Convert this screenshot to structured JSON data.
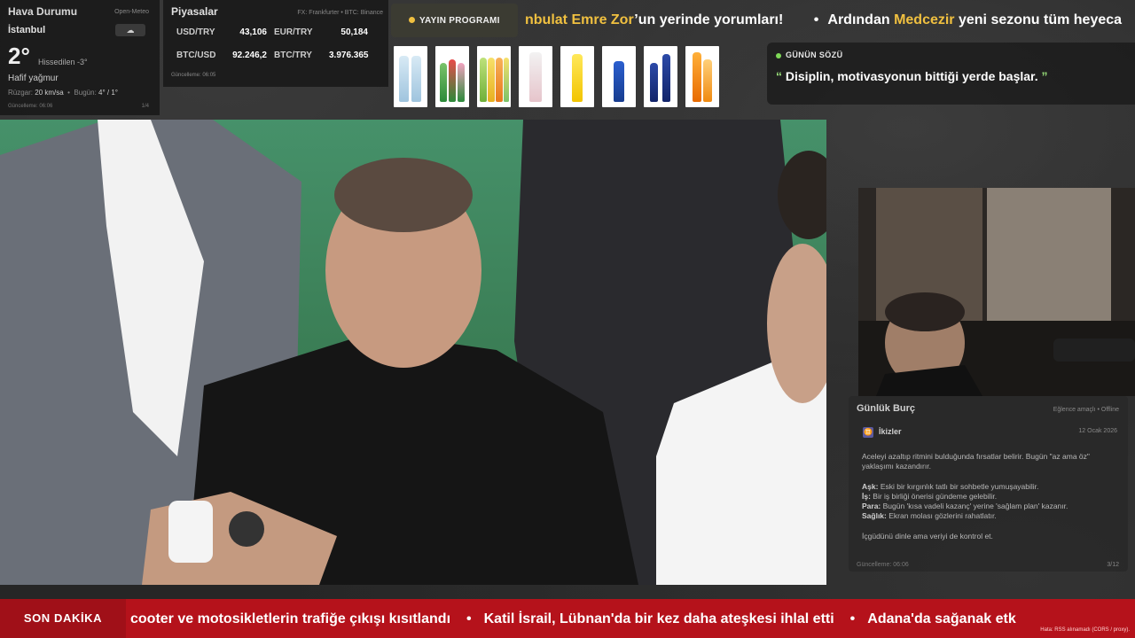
{
  "weather": {
    "title": "Hava Durumu",
    "source": "Open-Meteo",
    "city": "İstanbul",
    "temperature": "2°",
    "feels_like": "Hissedilen -3°",
    "condition": "Hafif yağmur",
    "wind_label": "Rüzgar",
    "wind_value": "20 km/sa",
    "today_label": "Bugün",
    "today_value": "4° / 1°",
    "updated": "Güncelleme: 06:06",
    "pager": "1/4",
    "icon": "cloud-rain-icon"
  },
  "markets": {
    "title": "Piyasalar",
    "source": "FX: Frankfurter • BTC: Binance",
    "rows": [
      {
        "k1": "USD/TRY",
        "v1": "43,106",
        "k2": "EUR/TRY",
        "v2": "50,184"
      },
      {
        "k1": "BTC/USD",
        "v1": "92.246,2",
        "k2": "BTC/TRY",
        "v2": "3.976.365"
      }
    ],
    "updated": "Güncelleme: 06:05"
  },
  "program": {
    "label": "YAYIN PROGRAMI"
  },
  "top_ticker": {
    "part1_pre": "",
    "part1_hl": "nbulat Emre Zor",
    "part1_post": "’un yerinde yorumları!",
    "sep": "•",
    "part2_pre": "Ardından ",
    "part2_hl": "Medcezir",
    "part2_post": " yeni sezonu tüm heyeca"
  },
  "quote": {
    "title": "GÜNÜN SÖZÜ",
    "open": "“",
    "text": "Disiplin, motivasyonun bittiği yerde başlar.",
    "close": "”"
  },
  "horoscope": {
    "title": "Günlük Burç",
    "mode": "Eğlence amaçlı • Offline",
    "sign_icon": "♊",
    "sign": "İkizler",
    "date": "12 Ocak 2026",
    "intro": "Aceleyi azaltıp ritmini bulduğunda fırsatlar belirir. Bugün \"az ama öz\" yaklaşımı kazandırır.",
    "love_label": "Aşk:",
    "love": "Eski bir kırgınlık tatlı bir sohbetle yumuşayabilir.",
    "work_label": "İş:",
    "work": "Bir iş birliği önerisi gündeme gelebilir.",
    "money_label": "Para:",
    "money": "Bugün 'kısa vadeli kazanç' yerine 'sağlam plan' kazanır.",
    "health_label": "Sağlık:",
    "health": "Ekran molası gözlerini rahatlatır.",
    "closing": "İçgüdünü dinle ama veriyi de kontrol et.",
    "updated": "Güncelleme: 06:06",
    "pager": "3/12"
  },
  "breaking": {
    "label": "SON DAKİKA",
    "item1": "cooter ve motosikletlerin trafiğe çıkışı kısıtlandı",
    "item2": "Katil İsrail, Lübnan'da bir kez daha ateşkesi ihlal etti",
    "item3": "Adana'da sağanak etk",
    "sep": "•",
    "error": "Hata: RSS alınamadı (CORS / proxy)."
  },
  "colors": {
    "accent_yellow": "#f0c040",
    "breaking_red": "#b5121b",
    "quote_green": "#7ed957"
  }
}
